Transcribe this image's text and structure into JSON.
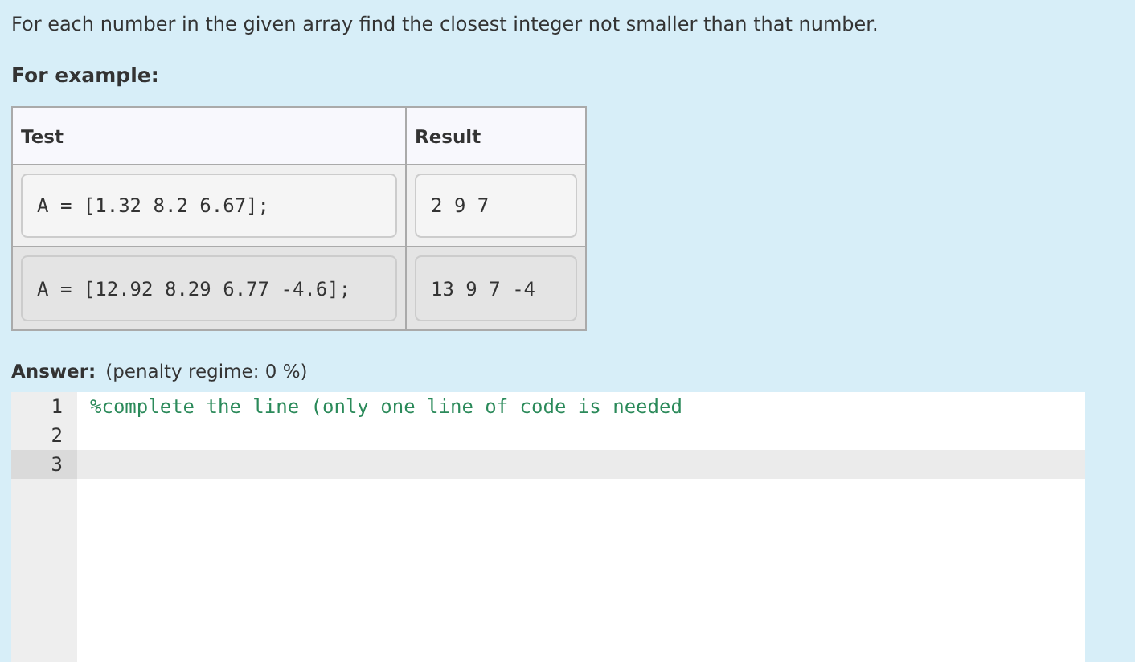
{
  "question": "For each number in the given array find the closest integer not smaller than that number.",
  "example_heading": "For example:",
  "table": {
    "columns": [
      "Test",
      "Result"
    ],
    "rows": [
      {
        "test": "A = [1.32 8.2 6.67];",
        "result": "2 9 7"
      },
      {
        "test": "A = [12.92 8.29 6.77 -4.6];",
        "result": "13 9 7 -4"
      }
    ]
  },
  "answer": {
    "label": "Answer:",
    "penalty": "(penalty regime: 0 %)"
  },
  "editor": {
    "lines": [
      {
        "number": "1",
        "code": "%complete the line (only one line of code is needed",
        "selected": false
      },
      {
        "number": "2",
        "selected": false
      },
      {
        "number": "3",
        "selected": true
      }
    ]
  }
}
